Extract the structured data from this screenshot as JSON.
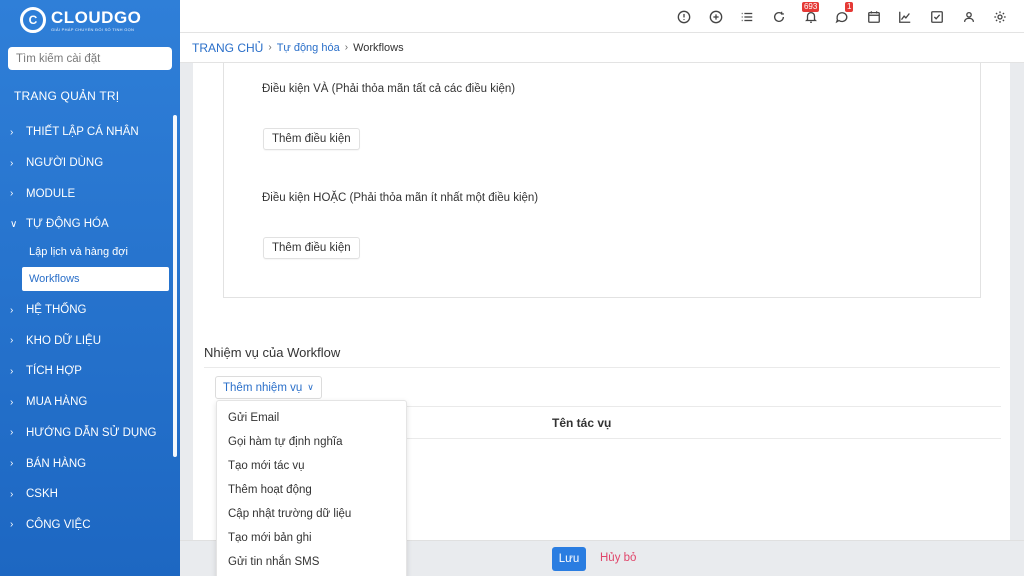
{
  "brand": {
    "logo_title": "CLOUDGO",
    "logo_sub": "GIẢI PHÁP CHUYỂN ĐỔI SỐ TINH GỌN"
  },
  "sidebar": {
    "search_placeholder": "Tìm kiếm cài đặt",
    "admin_title": "TRANG QUẢN TRỊ",
    "items": [
      {
        "label": "THIẾT LẬP CÁ NHÂN"
      },
      {
        "label": "NGƯỜI DÙNG"
      },
      {
        "label": "MODULE"
      },
      {
        "label": "TỰ ĐỘNG HÓA"
      },
      {
        "label": "HỆ THỐNG"
      },
      {
        "label": "KHO DỮ LIỆU"
      },
      {
        "label": "TÍCH HỢP"
      },
      {
        "label": "MUA HÀNG"
      },
      {
        "label": "HƯỚNG DẪN SỬ DỤNG"
      },
      {
        "label": "BÁN HÀNG"
      },
      {
        "label": "CSKH"
      },
      {
        "label": "CÔNG VIỆC"
      }
    ],
    "sub_items": [
      {
        "label": "Lập lịch và hàng đợi"
      },
      {
        "label": "Workflows"
      }
    ]
  },
  "topbar": {
    "notification_count": "693",
    "chat_count": "1"
  },
  "breadcrumb": {
    "home": "TRANG CHỦ",
    "section": "Tự động hóa",
    "current": "Workflows"
  },
  "conditions": {
    "and_label": "Điều kiện VÀ  (Phải thỏa mãn tất cả các điều kiện)",
    "or_label": "Điều kiện HOẶC  (Phải thỏa mãn ít nhất một điều kiện)",
    "add_button": "Thêm điều kiện"
  },
  "tasks": {
    "title": "Nhiệm vụ của Workflow",
    "add_button": "Thêm nhiệm vụ",
    "column_name": "Tên tác vụ",
    "dropdown": [
      "Gửi Email",
      "Gọi hàm tự định nghĩa",
      "Tạo mới tác vụ",
      "Thêm hoạt động",
      "Cập nhật trường dữ liệu",
      "Tạo mới bản ghi",
      "Gửi tin nhắn SMS"
    ]
  },
  "footer": {
    "save": "Lưu",
    "cancel": "Hủy bỏ"
  },
  "colors": {
    "sidebar": "#2a75d0",
    "accent": "#2a7de1",
    "cancel": "#e0456a",
    "badge": "#e53935"
  }
}
